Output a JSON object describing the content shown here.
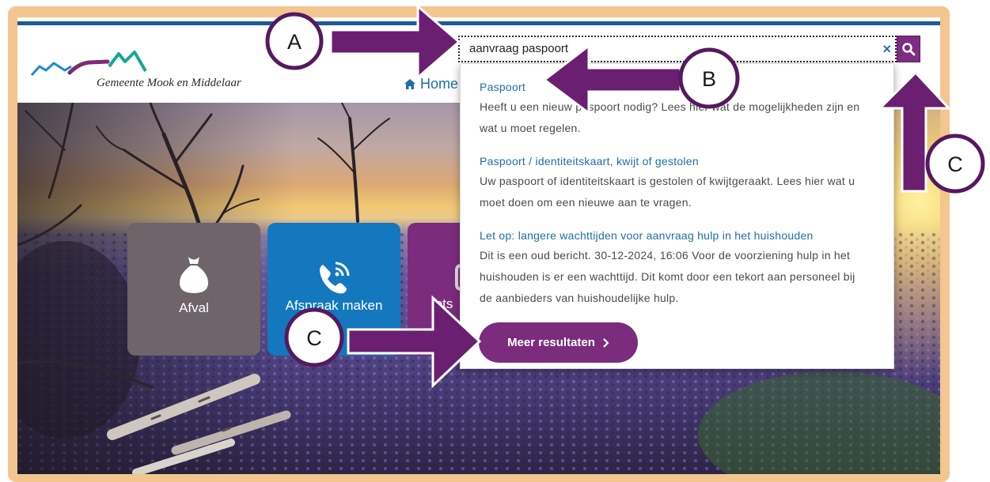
{
  "header": {
    "logo_text": "Gemeente Mook en Middelaar",
    "nav_home": "Home",
    "nav_home_icon": "home-icon"
  },
  "search": {
    "value": "aanvraag paspoort",
    "clear_label": "×",
    "clear_icon": "close-icon",
    "button_icon": "search-icon"
  },
  "results": [
    {
      "title": "Paspoort",
      "description_lines": [
        "Heeft u een nieuw paspoort nodig? Lees hier wat de mogelijkheden zijn en",
        "wat u moet regelen."
      ]
    },
    {
      "title": "Paspoort / identiteitskaart, kwijt of gestolen",
      "description_lines": [
        "Uw paspoort of identiteitskaart is gestolen of kwijtgeraakt. Lees hier wat u",
        "moet doen om een nieuwe aan te vragen."
      ]
    },
    {
      "title": "Let op: langere wachttijden voor aanvraag hulp in het huishouden",
      "description_lines": [
        "Dit is een oud bericht. 30-12-2024, 16:06 Voor de voorziening hulp in het",
        "huishouden is er een wachttijd. Dit komt door een tekort aan personeel bij",
        "de aanbieders van huishoudelijke hulp."
      ]
    }
  ],
  "more_results": {
    "label": "Meer resultaten",
    "icon": "chevron-right-icon"
  },
  "tiles": [
    {
      "label": "Afval",
      "icon": "trash-bag-icon",
      "color": "#6e6469"
    },
    {
      "label": "Afspraak maken",
      "icon": "phone-icon",
      "color": "#1378bd"
    },
    {
      "label": "Iets",
      "icon": "chat-icon",
      "color": "#7b2c7d"
    }
  ],
  "annotations": {
    "a": "A",
    "b": "B",
    "c_top": "C",
    "c_bottom": "C"
  },
  "colors": {
    "brand_blue": "#1b5c99",
    "link_blue": "#1f6fa5",
    "brand_purple": "#7b2c7d",
    "annotation_purple": "#6a1f70",
    "annotation_ring": "#55195f",
    "frame": "#f3c58f"
  }
}
